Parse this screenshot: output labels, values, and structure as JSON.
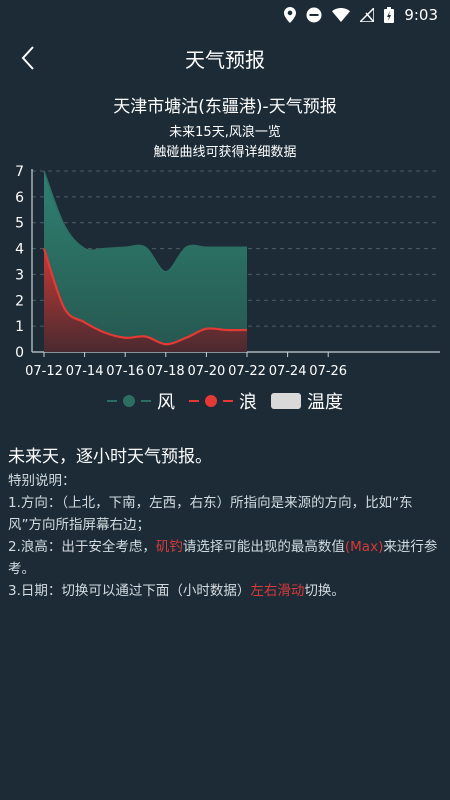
{
  "status_bar": {
    "time": "9:03"
  },
  "nav": {
    "title": "天气预报"
  },
  "chart_header": {
    "title": "天津市塘沽(东疆港)-天气预报",
    "subtitle1": "未来15天,风浪一览",
    "subtitle2": "触碰曲线可获得详细数据"
  },
  "legend": [
    {
      "label": "风",
      "color": "#2d6e62"
    },
    {
      "label": "浪",
      "color": "#e53935"
    },
    {
      "label": "温度",
      "color": "#d9d9d9"
    }
  ],
  "chart_data": {
    "type": "area",
    "x": [
      "07-12",
      "07-13",
      "07-14",
      "07-15",
      "07-16",
      "07-17",
      "07-18",
      "07-19",
      "07-20",
      "07-21",
      "07-22"
    ],
    "xticks": [
      "07-12",
      "07-14",
      "07-16",
      "07-18",
      "07-20",
      "07-22",
      "07-24",
      "07-26"
    ],
    "yticks": [
      0,
      1,
      2,
      3,
      4,
      5,
      6,
      7
    ],
    "ylim": [
      0,
      7
    ],
    "grid": true,
    "legend_position": "bottom",
    "series": [
      {
        "name": "风",
        "color": "#2d6e62",
        "values": [
          7.0,
          4.9,
          4.0,
          4.0,
          4.05,
          4.05,
          3.1,
          4.05,
          4.05,
          4.05,
          4.05
        ]
      },
      {
        "name": "浪",
        "color": "#e53935",
        "values": [
          4.0,
          1.7,
          1.15,
          0.75,
          0.55,
          0.6,
          0.3,
          0.55,
          0.9,
          0.85,
          0.85
        ]
      }
    ]
  },
  "info": {
    "title": "未来天，逐小时天气预报。",
    "heading": "特别说明：",
    "line1": "1.方向：（上北，下南，左西，右东）所指向是来源的方向，比如“东风”方向所指屏幕右边；",
    "line2_a": "2.浪高：出于安全考虑，",
    "line2_b": "矶钓",
    "line2_c": "请选择可能出现的最高数值",
    "line2_d": "(Max)",
    "line2_e": "来进行参考。",
    "line3_a": "3.日期：切换可以通过下面（小时数据）",
    "line3_b": "左右滑动",
    "line3_c": "切换。"
  }
}
